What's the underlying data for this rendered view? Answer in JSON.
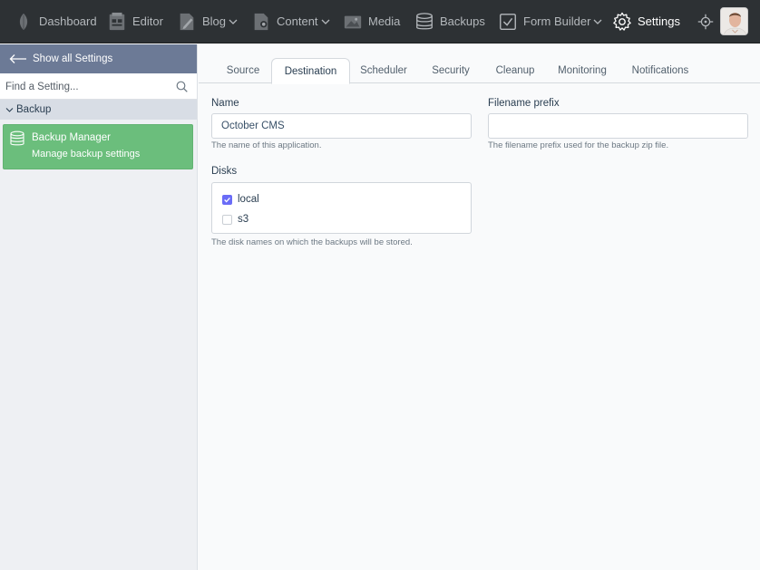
{
  "nav": {
    "items": [
      {
        "label": "Dashboard",
        "icon": "leaf-icon"
      },
      {
        "label": "Editor",
        "icon": "editor-icon"
      },
      {
        "label": "Blog",
        "icon": "blog-icon",
        "dropdown": true
      },
      {
        "label": "Content",
        "icon": "content-icon",
        "dropdown": true
      },
      {
        "label": "Media",
        "icon": "media-icon"
      },
      {
        "label": "Backups",
        "icon": "database-icon"
      },
      {
        "label": "Form Builder",
        "icon": "checkbox-icon",
        "dropdown": true
      },
      {
        "label": "Settings",
        "icon": "gear-icon",
        "active": true
      }
    ]
  },
  "sidebar": {
    "back_label": "Show all Settings",
    "search_placeholder": "Find a Setting...",
    "group_label": "Backup",
    "item": {
      "title": "Backup Manager",
      "description": "Manage backup settings"
    }
  },
  "tabs": [
    {
      "label": "Source"
    },
    {
      "label": "Destination",
      "active": true
    },
    {
      "label": "Scheduler"
    },
    {
      "label": "Security"
    },
    {
      "label": "Cleanup"
    },
    {
      "label": "Monitoring"
    },
    {
      "label": "Notifications"
    }
  ],
  "form": {
    "name_label": "Name",
    "name_value": "October CMS",
    "name_help": "The name of this application.",
    "prefix_label": "Filename prefix",
    "prefix_value": "",
    "prefix_help": "The filename prefix used for the backup zip file.",
    "disks_label": "Disks",
    "disks": [
      {
        "label": "local",
        "checked": true
      },
      {
        "label": "s3",
        "checked": false
      }
    ],
    "disks_help": "The disk names on which the backups will be stored."
  },
  "colors": {
    "accent_green": "#6bbe7c",
    "checkbox_accent": "#6a6cf7",
    "nav_bg": "#2d3134"
  }
}
